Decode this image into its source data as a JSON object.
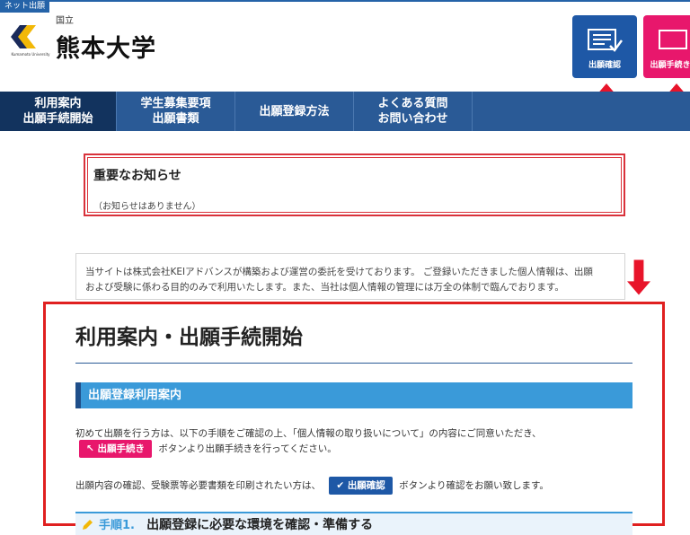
{
  "header": {
    "net_tag": "ネット出願",
    "logo_caption": "Kumamoto University",
    "national_label": "国立",
    "university_name": "熊本大学",
    "confirm_button": "出願確認",
    "apply_button": "出願手続き"
  },
  "nav": {
    "items": [
      {
        "label": "利用案内\n出願手続開始",
        "active": true
      },
      {
        "label": "学生募集要項\n出願書類",
        "active": false
      },
      {
        "label": "出願登録方法",
        "active": false
      },
      {
        "label": "よくある質問\nお問い合わせ",
        "active": false
      }
    ]
  },
  "notice": {
    "title": "重要なお知らせ",
    "text": "（お知らせはありません）"
  },
  "info": {
    "line1": "当サイトは株式会社KEIアドバンスが構築および運営の委託を受けております。 ご登録いただきました個人情報は、出願",
    "line2": "および受験に係わる目的のみで利用いたします。また、当社は個人情報の管理には万全の体制で臨んでおります。"
  },
  "main": {
    "title": "利用案内・出願手続開始",
    "subheading": "出願登録利用案内",
    "para1": "初めて出願を行う方は、以下の手順をご確認の上、「個人情報の取り扱いについて」の内容にご同意いただき、",
    "apply_inline_button": "出願手続き",
    "para1_suffix": "ボタンより出願手続きを行ってください。",
    "para2": "出願内容の確認、受験票等必要書類を印刷されたい方は、",
    "confirm_inline_button": "出願確認",
    "para2_suffix": "ボタンより確認をお願い致します。",
    "step_number": "手順1.",
    "step_text": "出願登録に必要な環境を確認・準備する"
  },
  "colors": {
    "nav_bg": "#2a5a96",
    "nav_active": "#12335e",
    "confirm_blue": "#1e58a6",
    "apply_pink": "#e8176c",
    "highlight_red": "#e02020",
    "subheading_blue": "#3a9ad9"
  }
}
